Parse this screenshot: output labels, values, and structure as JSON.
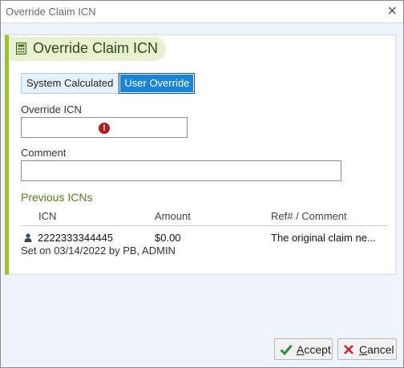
{
  "window": {
    "title": "Override Claim ICN",
    "close_label": "×"
  },
  "panel": {
    "title": "Override Claim ICN"
  },
  "mode_toggle": {
    "options": [
      "System Calculated",
      "User Override"
    ],
    "selected": "User Override"
  },
  "form": {
    "override_icn_label": "Override ICN",
    "override_icn_value": "",
    "error_glyph": "!",
    "comment_label": "Comment",
    "comment_value": ""
  },
  "previous": {
    "title": "Previous ICNs",
    "columns": [
      "ICN",
      "Amount",
      "Ref# / Comment"
    ],
    "rows": [
      {
        "icn": "2222333344445",
        "amount": "$0.00",
        "ref_comment": "The original claim ne...",
        "set_on": "Set on 03/14/2022 by PB, ADMIN"
      }
    ]
  },
  "buttons": {
    "accept_first": "A",
    "accept_rest": "ccept",
    "cancel_first": "C",
    "cancel_rest": "ancel"
  },
  "colors": {
    "accent_green": "#9ac42a",
    "selected_blue": "#1a84d6",
    "error_red": "#b01e23"
  }
}
